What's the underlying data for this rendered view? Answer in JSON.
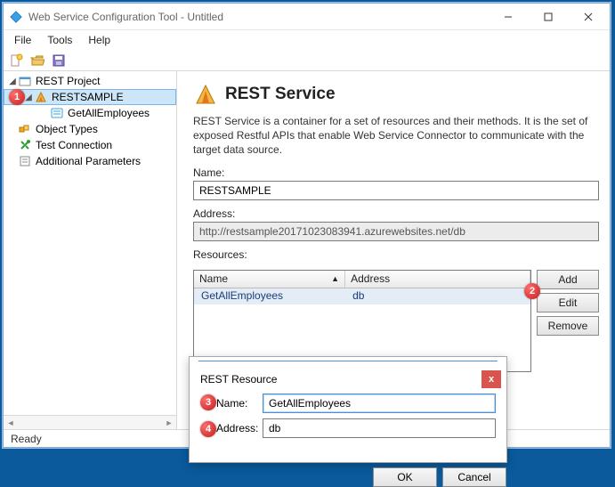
{
  "window": {
    "title": "Web Service Configuration Tool - Untitled"
  },
  "menus": {
    "file": "File",
    "tools": "Tools",
    "help": "Help"
  },
  "tree": {
    "root": "REST Project",
    "sample": "RESTSAMPLE",
    "method": "GetAllEmployees",
    "object_types": "Object Types",
    "test_conn": "Test Connection",
    "add_params": "Additional Parameters"
  },
  "markers": {
    "m1": "1",
    "m2": "2",
    "m3": "3",
    "m4": "4"
  },
  "service": {
    "heading": "REST Service",
    "desc": "REST Service is a container for a set of resources and their methods. It is the set of exposed Restful APIs that enable Web Service Connector to communicate with the target data source.",
    "name_label": "Name:",
    "name_value": "RESTSAMPLE",
    "addr_label": "Address:",
    "addr_value": "http://restsample20171023083941.azurewebsites.net/db",
    "res_label": "Resources:",
    "cols": {
      "name": "Name",
      "addr": "Address"
    },
    "rows": [
      {
        "name": "GetAllEmployees",
        "addr": "db"
      }
    ],
    "btns": {
      "add": "Add",
      "edit": "Edit",
      "remove": "Remove"
    }
  },
  "dialog": {
    "title": "REST Resource",
    "name_label": "Name:",
    "name_value": "GetAllEmployees",
    "addr_label": "Address:",
    "addr_value": "db",
    "ok": "OK",
    "cancel": "Cancel",
    "close_glyph": "x"
  },
  "status": {
    "ready": "Ready"
  }
}
